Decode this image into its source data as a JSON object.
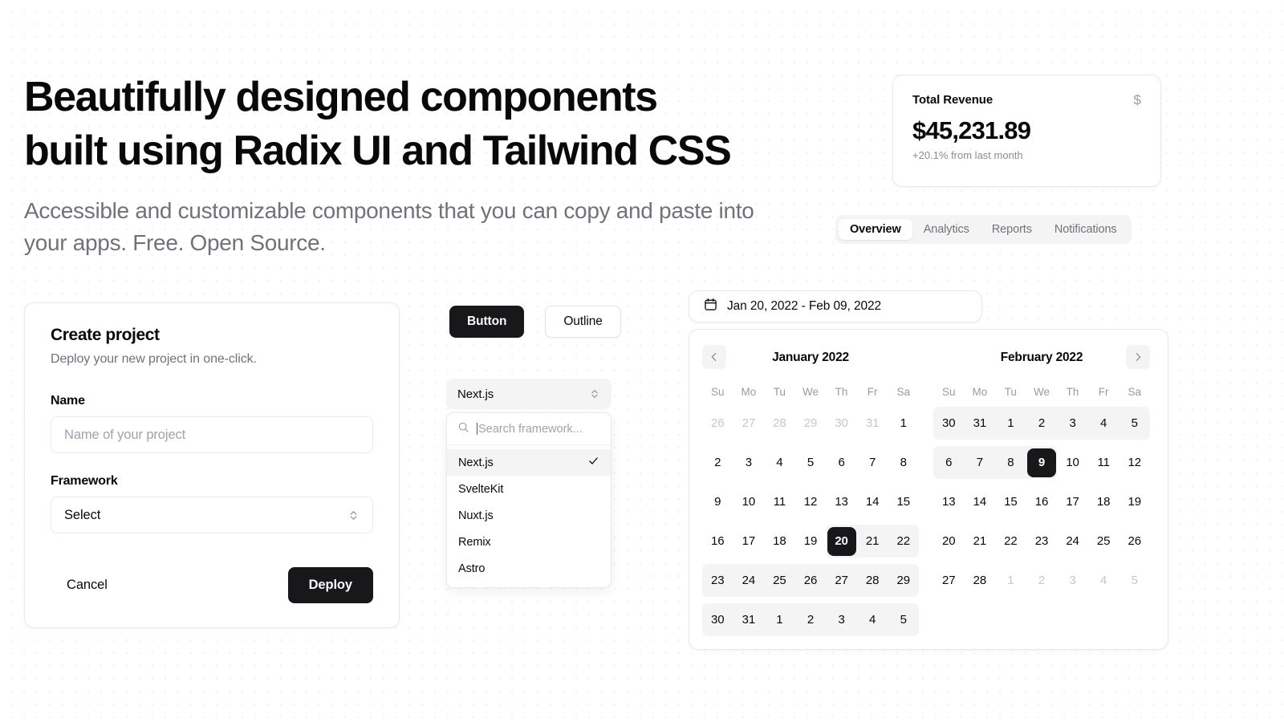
{
  "hero": {
    "title_line1": "Beautifully designed components",
    "title_line2": "built using Radix UI and Tailwind CSS",
    "subtitle": "Accessible and customizable components that you can copy and paste into your apps. Free. Open Source."
  },
  "revenue_card": {
    "title": "Total Revenue",
    "currency_icon": "$",
    "value": "$45,231.89",
    "change": "+20.1% from last month"
  },
  "tabs": {
    "items": [
      {
        "label": "Overview",
        "active": true
      },
      {
        "label": "Analytics",
        "active": false
      },
      {
        "label": "Reports",
        "active": false
      },
      {
        "label": "Notifications",
        "active": false
      }
    ]
  },
  "create_project": {
    "title": "Create project",
    "subtitle": "Deploy your new project in one-click.",
    "name_label": "Name",
    "name_value": "",
    "name_placeholder": "Name of your project",
    "framework_label": "Framework",
    "framework_value": "Select",
    "cancel_label": "Cancel",
    "deploy_label": "Deploy"
  },
  "button_demo": {
    "solid_label": "Button",
    "outline_label": "Outline"
  },
  "combobox": {
    "trigger_value": "Next.js",
    "search_placeholder": "Search framework...",
    "search_value": "",
    "options": [
      {
        "label": "Next.js",
        "selected": true
      },
      {
        "label": "SvelteKit",
        "selected": false
      },
      {
        "label": "Nuxt.js",
        "selected": false
      },
      {
        "label": "Remix",
        "selected": false
      },
      {
        "label": "Astro",
        "selected": false
      }
    ]
  },
  "date_range": {
    "display": "Jan 20, 2022 - Feb 09, 2022",
    "weekdays": [
      "Su",
      "Mo",
      "Tu",
      "We",
      "Th",
      "Fr",
      "Sa"
    ],
    "months": [
      {
        "title": "January 2022",
        "weeks": [
          [
            {
              "d": "26",
              "muted": true
            },
            {
              "d": "27",
              "muted": true
            },
            {
              "d": "28",
              "muted": true
            },
            {
              "d": "29",
              "muted": true
            },
            {
              "d": "30",
              "muted": true
            },
            {
              "d": "31",
              "muted": true
            },
            {
              "d": "1",
              "muted": false
            }
          ],
          [
            {
              "d": "2"
            },
            {
              "d": "3"
            },
            {
              "d": "4"
            },
            {
              "d": "5"
            },
            {
              "d": "6"
            },
            {
              "d": "7"
            },
            {
              "d": "8"
            }
          ],
          [
            {
              "d": "9"
            },
            {
              "d": "10"
            },
            {
              "d": "11"
            },
            {
              "d": "12"
            },
            {
              "d": "13"
            },
            {
              "d": "14"
            },
            {
              "d": "15"
            }
          ],
          [
            {
              "d": "16"
            },
            {
              "d": "17"
            },
            {
              "d": "18"
            },
            {
              "d": "19"
            },
            {
              "d": "20",
              "endpoint": true
            },
            {
              "d": "21"
            },
            {
              "d": "22"
            }
          ],
          [
            {
              "d": "23"
            },
            {
              "d": "24"
            },
            {
              "d": "25"
            },
            {
              "d": "26"
            },
            {
              "d": "27"
            },
            {
              "d": "28"
            },
            {
              "d": "29"
            }
          ],
          [
            {
              "d": "30"
            },
            {
              "d": "31"
            },
            {
              "d": "1"
            },
            {
              "d": "2"
            },
            {
              "d": "3"
            },
            {
              "d": "4"
            },
            {
              "d": "5"
            }
          ]
        ],
        "bands": [
          null,
          null,
          null,
          {
            "start": 4,
            "end": 6
          },
          {
            "start": 0,
            "end": 6
          },
          {
            "start": 0,
            "end": 6
          }
        ]
      },
      {
        "title": "February 2022",
        "weeks": [
          [
            {
              "d": "30"
            },
            {
              "d": "31"
            },
            {
              "d": "1"
            },
            {
              "d": "2"
            },
            {
              "d": "3"
            },
            {
              "d": "4"
            },
            {
              "d": "5"
            }
          ],
          [
            {
              "d": "6"
            },
            {
              "d": "7"
            },
            {
              "d": "8"
            },
            {
              "d": "9",
              "endpoint": true
            },
            {
              "d": "10"
            },
            {
              "d": "11"
            },
            {
              "d": "12"
            }
          ],
          [
            {
              "d": "13"
            },
            {
              "d": "14"
            },
            {
              "d": "15"
            },
            {
              "d": "16"
            },
            {
              "d": "17"
            },
            {
              "d": "18"
            },
            {
              "d": "19"
            }
          ],
          [
            {
              "d": "20"
            },
            {
              "d": "21"
            },
            {
              "d": "22"
            },
            {
              "d": "23"
            },
            {
              "d": "24"
            },
            {
              "d": "25"
            },
            {
              "d": "26"
            }
          ],
          [
            {
              "d": "27"
            },
            {
              "d": "28"
            },
            {
              "d": "1",
              "muted": true
            },
            {
              "d": "2",
              "muted": true
            },
            {
              "d": "3",
              "muted": true
            },
            {
              "d": "4",
              "muted": true
            },
            {
              "d": "5",
              "muted": true
            }
          ]
        ],
        "bands": [
          {
            "start": 0,
            "end": 6
          },
          {
            "start": 0,
            "end": 3
          },
          null,
          null,
          null
        ]
      }
    ],
    "prev_label": "‹",
    "next_label": "›"
  },
  "colors": {
    "accent": "#18181b",
    "muted_bg": "#f4f4f5",
    "border": "#e9e9ec",
    "text_muted": "#71717a"
  }
}
